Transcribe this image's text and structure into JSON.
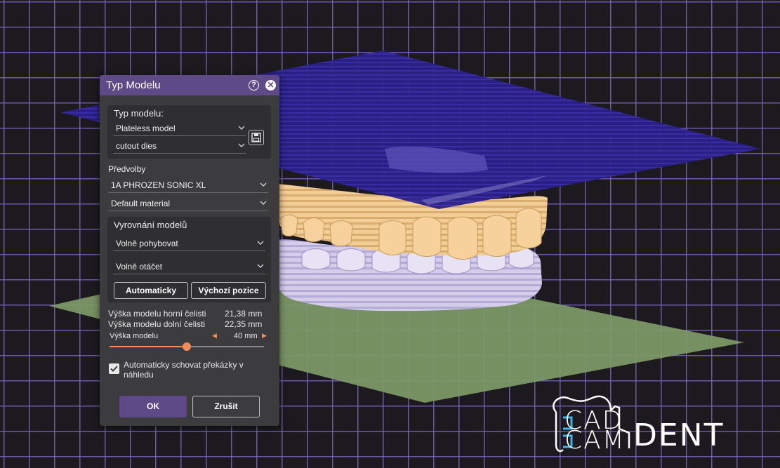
{
  "dialog": {
    "title": "Typ Modelu",
    "model_type": {
      "label": "Typ modelu:",
      "type_value": "Plateless model",
      "die_value": "cutout dies"
    },
    "presets": {
      "label": "Předvolby",
      "printer_value": "1A PHROZEN SONIC XL",
      "material_value": "Default material"
    },
    "alignment": {
      "label": "Vyrovnání modelů",
      "move_value": "Volně pohybovat",
      "rotate_value": "Volně otáčet",
      "auto_button": "Automaticky",
      "default_button": "Výchozí pozice"
    },
    "stats": {
      "upper_label": "Výška modelu horní čelisti",
      "upper_value": "21,38 mm",
      "lower_label": "Výška modelu dolní čelisti",
      "lower_value": "22,35 mm"
    },
    "model_height": {
      "label": "Výška modelu",
      "value_text": "40 mm",
      "slider_fraction": 0.5
    },
    "auto_hide": {
      "checked": true,
      "label_line1": "Automaticky schovat překázky v",
      "label_line2": "náhledu"
    },
    "ok_button": "OK",
    "cancel_button": "Zrušit"
  },
  "logo": {
    "line1": "CAD",
    "line2": "CAM",
    "word": "DENT"
  },
  "colors": {
    "titlebar": "#5e4a86",
    "ok_button": "#5e4a86",
    "slider_accent": "#f28c5c",
    "grid": "#7a62c8",
    "upper_plane": "#2a1f88",
    "lower_plane": "#7e9a68",
    "upper_teeth": "#f0c78e",
    "lower_teeth": "#cdc6e6"
  }
}
